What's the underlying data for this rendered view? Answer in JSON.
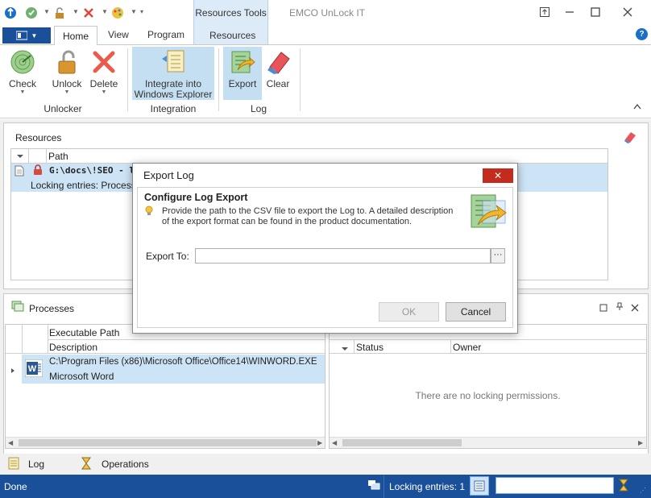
{
  "titlebar": {
    "app_title": "EMCO UnLock IT",
    "context_tab_title": "Resources Tools"
  },
  "tabs": {
    "file_icon": "menu-icon",
    "home": "Home",
    "view": "View",
    "program": "Program",
    "resources": "Resources"
  },
  "ribbon": {
    "check": "Check",
    "unlock": "Unlock",
    "delete": "Delete",
    "integrate": "Integrate into Windows Explorer",
    "export": "Export",
    "clear": "Clear",
    "group_unlocker": "Unlocker",
    "group_integration": "Integration",
    "group_log": "Log"
  },
  "resources": {
    "title": "Resources",
    "column_path": "Path",
    "row_path": "G:\\docs\\!SEO - loca",
    "row_detail": "Locking entries: Processes"
  },
  "processes": {
    "title": "Processes",
    "col_exec": "Executable Path",
    "col_desc": "Description",
    "row_path": "C:\\Program Files (x86)\\Microsoft Office\\Office14\\WINWORD.EXE",
    "row_desc": "Microsoft Word"
  },
  "locks": {
    "col_status": "Status",
    "col_owner": "Owner",
    "empty": "There are no locking permissions."
  },
  "bottom_tabs": {
    "log": "Log",
    "operations": "Operations"
  },
  "statusbar": {
    "left": "Done",
    "locking": "Locking entries: 1"
  },
  "dialog": {
    "title": "Export Log",
    "heading": "Configure Log Export",
    "desc_line1": "Provide the path to the CSV file to export the Log to. A detailed description",
    "desc_line2": "of the export format can be found in the product documentation.",
    "export_to_label": "Export To:",
    "export_to_value": "",
    "browse": "···",
    "ok": "OK",
    "cancel": "Cancel",
    "close": "✕"
  },
  "colors": {
    "accent": "#1a4f9a",
    "selection": "#cde4f6",
    "close_red": "#c42b1c"
  }
}
